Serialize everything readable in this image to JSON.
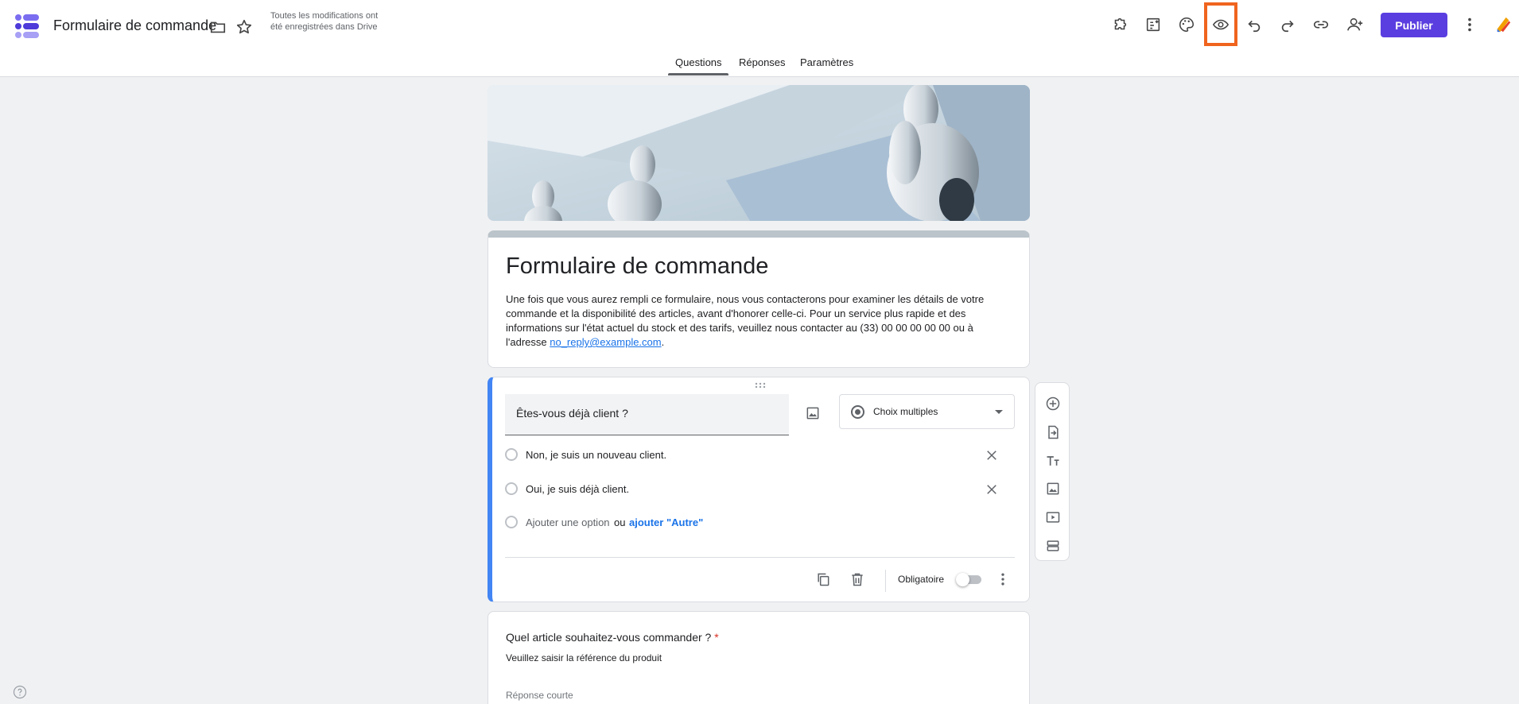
{
  "app": {
    "document_title": "Formulaire de commande",
    "save_status": "Toutes les modifications ont été enregistrées dans Drive",
    "publish_label": "Publier"
  },
  "toolbar_icons": [
    "add-ons-icon",
    "customize-icon",
    "palette-icon",
    "preview-eye-icon",
    "undo-icon",
    "redo-icon",
    "link-icon",
    "add-collaborator-icon",
    "more-vert-icon"
  ],
  "tabs": [
    {
      "label": "Questions",
      "active": true
    },
    {
      "label": "Réponses",
      "active": false
    },
    {
      "label": "Paramètres",
      "active": false
    }
  ],
  "form": {
    "title": "Formulaire de commande",
    "description_before_link": "Une fois que vous aurez rempli ce formulaire, nous vous contacterons pour examiner les détails de votre commande et la disponibilité des articles, avant d'honorer celle-ci. Pour un service plus rapide et des informations sur l'état actuel du stock et des tarifs, veuillez nous contacter au (33) 00 00 00 00 00 ou à l'adresse ",
    "description_link": "no_reply@example.com",
    "description_after_link": "."
  },
  "question1": {
    "text": "Êtes-vous déjà client ?",
    "type": "Choix multiples",
    "options": [
      "Non, je suis un nouveau client.",
      "Oui, je suis déjà client."
    ],
    "add_option": "Ajouter une option",
    "or": "ou",
    "add_other": "ajouter \"Autre\"",
    "required_label": "Obligatoire",
    "required": false
  },
  "question2": {
    "text": "Quel article souhaitez-vous commander ?",
    "required_mark": "*",
    "description": "Veuillez saisir la référence du produit",
    "answer_placeholder": "Réponse courte"
  },
  "colors": {
    "accent": "#5b3ee0",
    "question_highlight": "#4285f4",
    "annotation_box": "#f0641e",
    "link": "#1a73e8"
  }
}
